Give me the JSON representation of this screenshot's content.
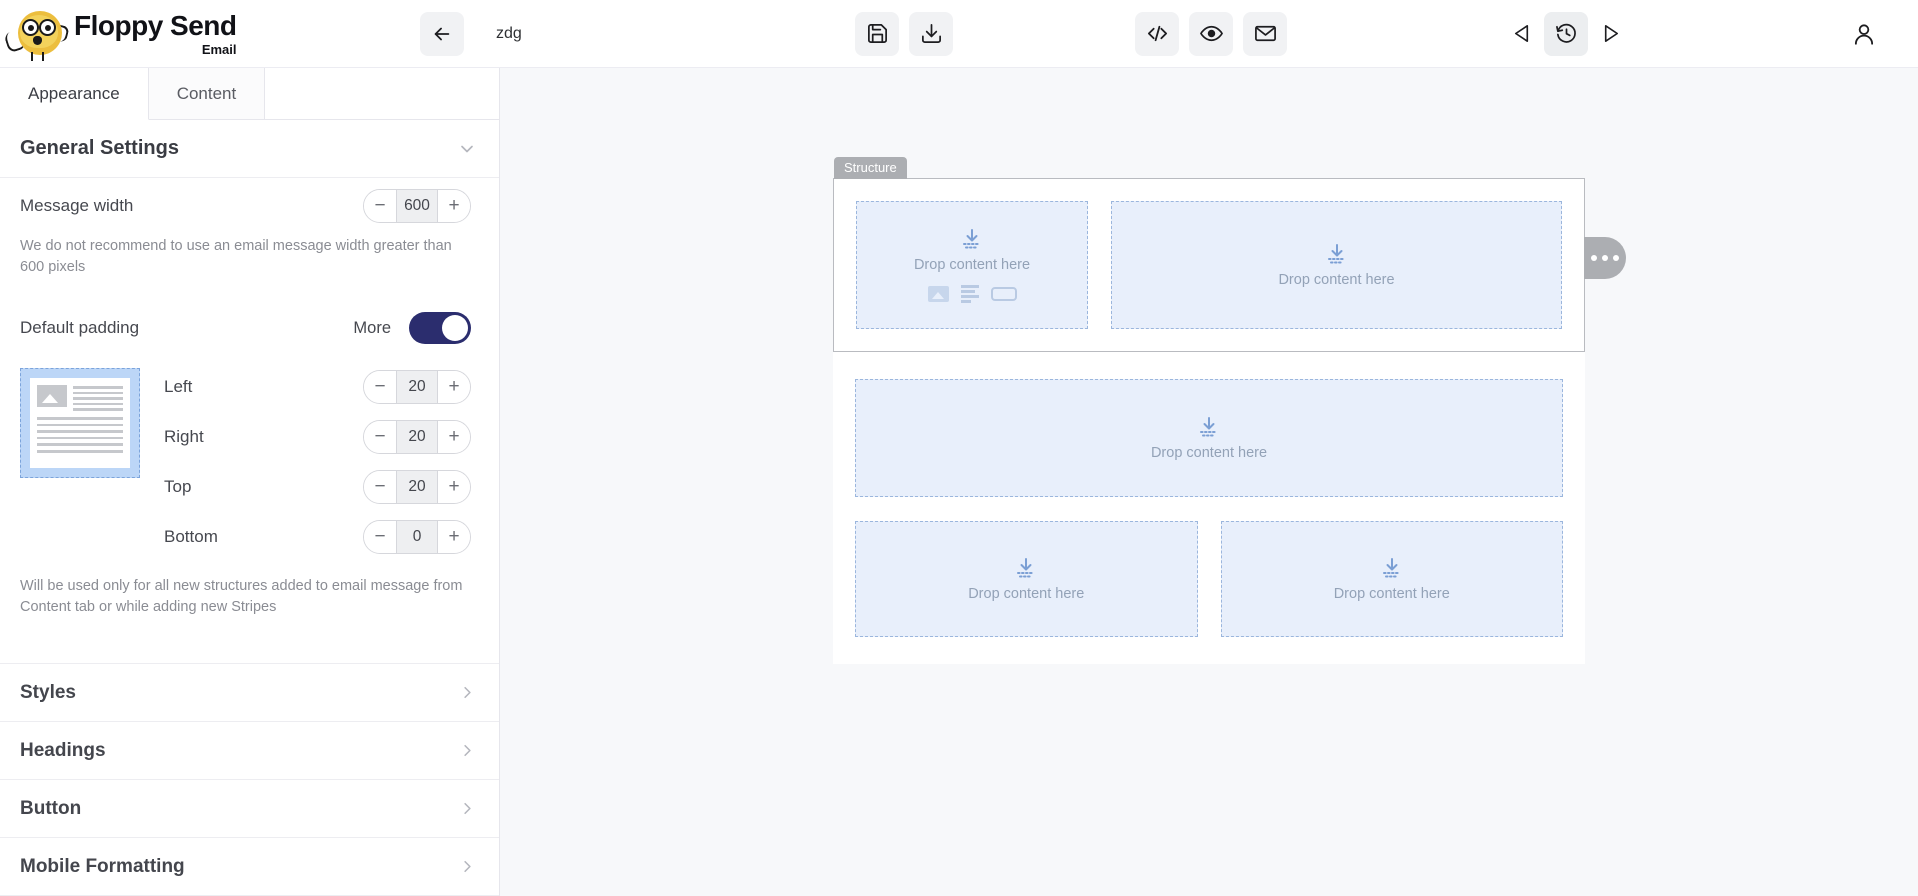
{
  "brand": {
    "name": "Floppy Send",
    "sub": "Email",
    "logo_icon": "owl-mascot-icon"
  },
  "topbar": {
    "back_icon": "arrow-left-icon",
    "document_title": "zdg",
    "save_icon": "floppy-disk-save-icon",
    "download_icon": "download-icon",
    "code_icon": "code-brackets-icon",
    "preview_icon": "eye-preview-icon",
    "email_icon": "envelope-icon",
    "undo_icon": "triangle-left-undo-icon",
    "history_icon": "clock-history-icon",
    "redo_icon": "triangle-right-redo-icon",
    "account_icon": "user-account-icon"
  },
  "sidebar": {
    "tabs": [
      {
        "label": "Appearance",
        "active": true
      },
      {
        "label": "Content",
        "active": false
      }
    ],
    "general_settings": {
      "title": "General Settings",
      "collapse_icon": "chevron-down-icon",
      "message_width": {
        "label": "Message width",
        "value": "600",
        "minus": "−",
        "plus": "+",
        "hint": "We do not recommend to use an email message width greater than 600 pixels"
      },
      "default_padding": {
        "label": "Default padding",
        "more_label": "More",
        "toggle_on": true,
        "toggle_color": "#2b2d6e",
        "preview_icon": "padding-preview-thumbnail",
        "fields": [
          {
            "label": "Left",
            "value": "20"
          },
          {
            "label": "Right",
            "value": "20"
          },
          {
            "label": "Top",
            "value": "20"
          },
          {
            "label": "Bottom",
            "value": "0"
          }
        ],
        "hint": "Will be used only for all new structures added to email message from Content tab or while adding new Stripes"
      }
    },
    "sections": [
      {
        "label": "Styles",
        "chevron": "chevron-right-icon"
      },
      {
        "label": "Headings",
        "chevron": "chevron-right-icon"
      },
      {
        "label": "Button",
        "chevron": "chevron-right-icon"
      },
      {
        "label": "Mobile Formatting",
        "chevron": "chevron-right-icon"
      }
    ]
  },
  "canvas": {
    "structure_label": "Structure",
    "options_icon": "three-dots-menu-icon",
    "drop_icon": "drop-here-arrow-icon",
    "quick_add": {
      "image_icon": "image-block-icon",
      "text_icon": "text-block-icon",
      "button_icon": "button-block-icon"
    },
    "dropzones": [
      {
        "text": "Drop content here",
        "has_quick_add": true
      },
      {
        "text": "Drop content here",
        "has_quick_add": false
      },
      {
        "text": "Drop content here",
        "has_quick_add": false
      },
      {
        "text": "Drop content here",
        "has_quick_add": false
      },
      {
        "text": "Drop content here",
        "has_quick_add": false
      }
    ]
  }
}
